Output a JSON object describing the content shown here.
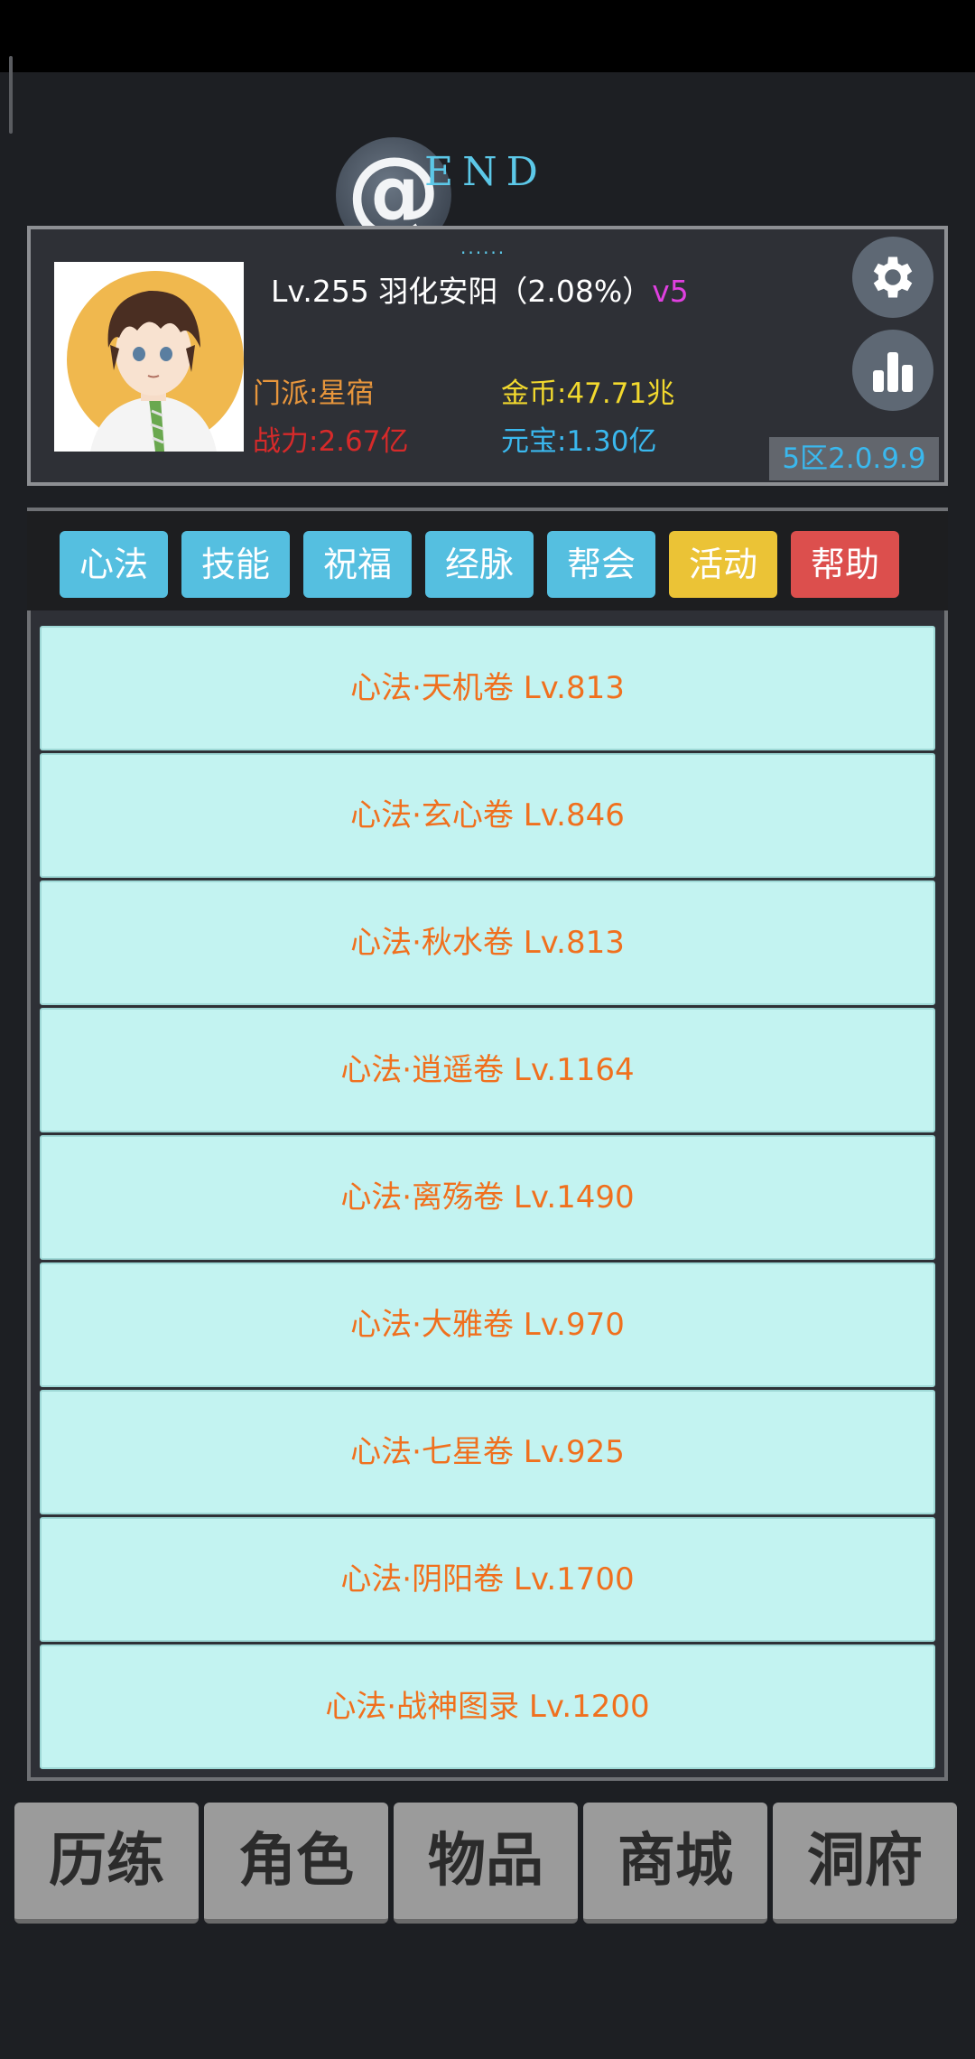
{
  "header": {
    "logo_symbol": "@",
    "logo_text": "END",
    "dots": "......"
  },
  "player": {
    "level_label": "Lv.255",
    "name": "羽化安阳",
    "exp_percent": "（2.08%）",
    "vip": "v5",
    "sect": "门派:星宿",
    "gold": "金币:47.71兆",
    "power": "战力:2.67亿",
    "ingot": "元宝:1.30亿",
    "server_version": "5区2.0.9.9"
  },
  "icons": {
    "settings": "gear-icon",
    "ranking": "bar-chart-icon"
  },
  "tabs": [
    {
      "label": "心法",
      "color": "#55bfe0"
    },
    {
      "label": "技能",
      "color": "#55bfe0"
    },
    {
      "label": "祝福",
      "color": "#55bfe0"
    },
    {
      "label": "经脉",
      "color": "#55bfe0"
    },
    {
      "label": "帮会",
      "color": "#55bfe0"
    },
    {
      "label": "活动",
      "color": "#ebc336"
    },
    {
      "label": "帮助",
      "color": "#dc4f4d"
    }
  ],
  "items": [
    "心法·天机卷 Lv.813",
    "心法·玄心卷 Lv.846",
    "心法·秋水卷 Lv.813",
    "心法·逍遥卷 Lv.1164",
    "心法·离殇卷 Lv.1490",
    "心法·大雅卷 Lv.970",
    "心法·七星卷 Lv.925",
    "心法·阴阳卷 Lv.1700",
    "心法·战神图录 Lv.1200"
  ],
  "bottom_nav": [
    "历练",
    "角色",
    "物品",
    "商城",
    "洞府"
  ],
  "colors": {
    "background": "#1d1f23",
    "panel": "#2e3036",
    "item_bg": "#c3f3f1",
    "item_text": "#f0701e",
    "accent_blue": "#3ab8ee",
    "gold_text": "#f2d92e",
    "power_text": "#d62a2a",
    "sect_text": "#e8963c",
    "vip_text": "#e040e0"
  }
}
